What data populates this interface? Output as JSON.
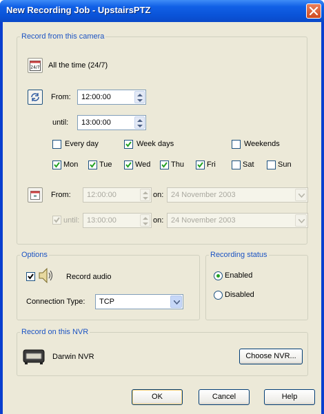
{
  "window": {
    "title": "New Recording Job - UpstairsPTZ"
  },
  "record_from": {
    "legend": "Record from this camera",
    "always_icon_text": "24/7",
    "always_label": "All the time (24/7)",
    "schedule": {
      "from_label": "From:",
      "from_value": "12:00:00",
      "until_label": "until:",
      "until_value": "13:00:00"
    },
    "groups": {
      "every_day": {
        "label": "Every day",
        "checked": false
      },
      "week_days": {
        "label": "Week days",
        "checked": true
      },
      "weekends": {
        "label": "Weekends",
        "checked": false
      }
    },
    "days": [
      {
        "label": "Mon",
        "checked": true
      },
      {
        "label": "Tue",
        "checked": true
      },
      {
        "label": "Wed",
        "checked": true
      },
      {
        "label": "Thu",
        "checked": true
      },
      {
        "label": "Fri",
        "checked": true
      },
      {
        "label": "Sat",
        "checked": false
      },
      {
        "label": "Sun",
        "checked": false
      }
    ],
    "once": {
      "from_label": "From:",
      "from_time": "12:00:00",
      "on_label": "on:",
      "from_date": "24 November 2003",
      "until_label": "until:",
      "until_time": "13:00:00",
      "until_on_label": "on:",
      "until_date": "24 November 2003"
    }
  },
  "options": {
    "legend": "Options",
    "record_audio_label": "Record audio",
    "record_audio_checked": true,
    "connection_type_label": "Connection Type:",
    "connection_type_value": "TCP"
  },
  "recording_status": {
    "legend": "Recording status",
    "enabled_label": "Enabled",
    "disabled_label": "Disabled",
    "selected": "enabled"
  },
  "nvr": {
    "legend": "Record on this NVR",
    "name": "Darwin NVR",
    "choose_button": "Choose NVR..."
  },
  "buttons": {
    "ok": "OK",
    "cancel": "Cancel",
    "help": "Help"
  },
  "colors": {
    "title_bar": "#0a53d8",
    "dialog_bg": "#ece9d8",
    "group_legend": "#1b53c3",
    "close_button": "#cf4a1f"
  }
}
